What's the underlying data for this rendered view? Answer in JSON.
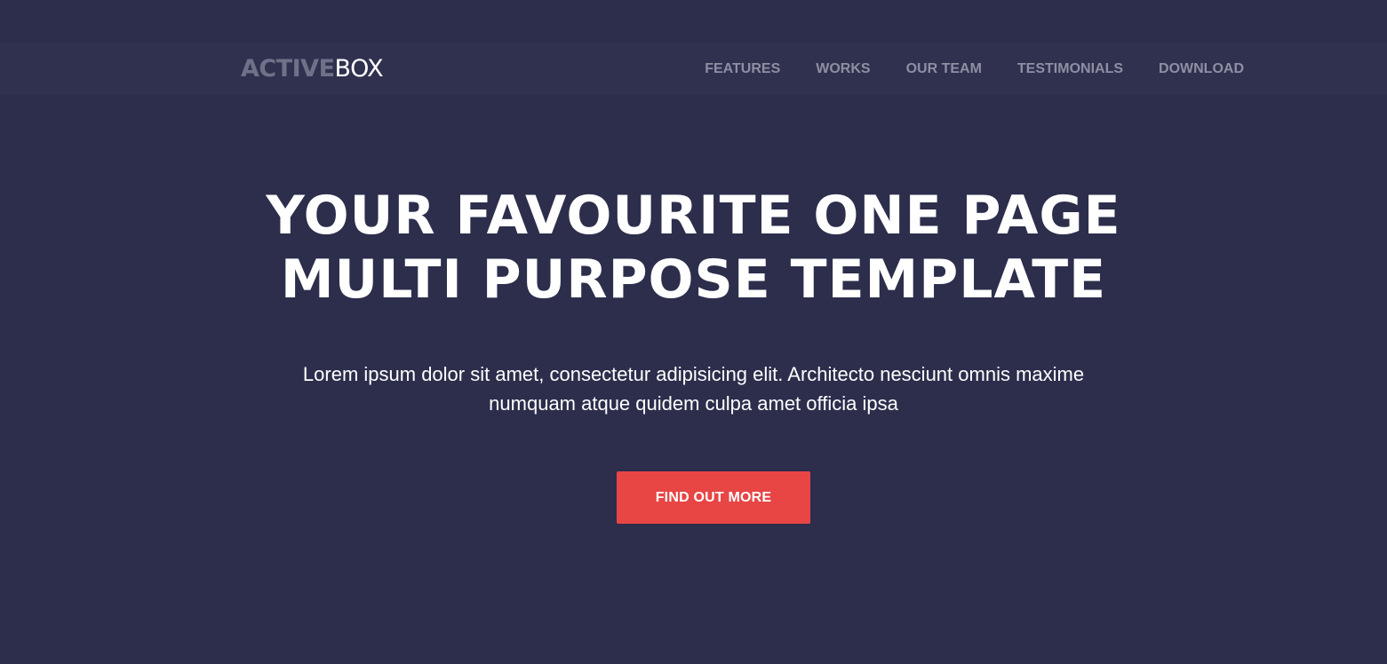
{
  "brand": {
    "bold": "ACTIVE",
    "light": "BOX"
  },
  "nav": {
    "items": [
      {
        "label": "FEATURES"
      },
      {
        "label": "WORKS"
      },
      {
        "label": "OUR TEAM"
      },
      {
        "label": "TESTIMONIALS"
      },
      {
        "label": "DOWNLOAD"
      }
    ]
  },
  "hero": {
    "title_line1": "YOUR FAVOURITE ONE PAGE",
    "title_line2": "MULTI PURPOSE TEMPLATE",
    "subtitle": "Lorem ipsum dolor sit amet, consectetur adipisicing elit. Architecto nesciunt omnis maxime numquam atque quidem culpa amet officia ipsa",
    "cta_label": "FIND OUT MORE"
  },
  "colors": {
    "background": "#2c2e4c",
    "navbar": "#2f314f",
    "accent": "#e84545",
    "nav_text": "#8e8fa3"
  }
}
